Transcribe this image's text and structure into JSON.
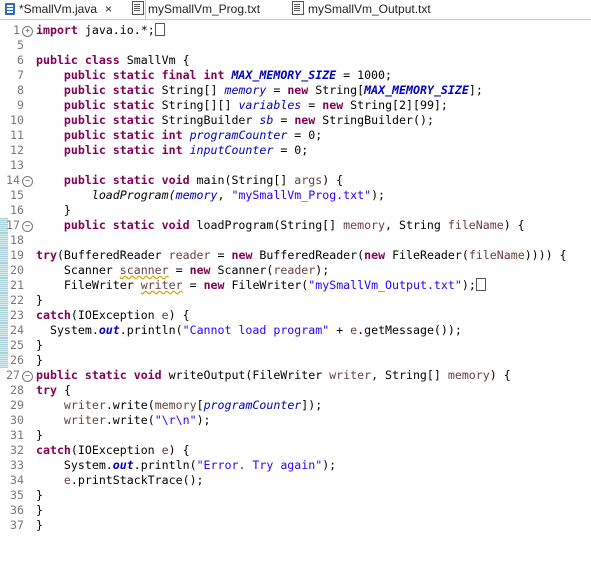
{
  "tabs": [
    {
      "label": "*SmallVm.java",
      "icon": "java-file-icon",
      "active": true,
      "close": "×"
    },
    {
      "label": "mySmallVm_Prog.txt",
      "icon": "text-file-icon",
      "active": false
    },
    {
      "label": "mySmallVm_Output.txt",
      "icon": "text-file-icon",
      "active": false
    }
  ],
  "colors": {
    "keyword": "#7f0055",
    "string": "#2a00ff",
    "field": "#0000c0",
    "local": "#6a3e3e",
    "line_number": "#787878"
  },
  "lines": [
    {
      "n": "1",
      "fold": "+",
      "tokens": [
        [
          "kw",
          "import"
        ],
        [
          "",
          "java.io.*;"
        ],
        [
          "caret",
          ""
        ]
      ]
    },
    {
      "n": "5",
      "tokens": []
    },
    {
      "n": "6",
      "tokens": [
        [
          "kw",
          "public class"
        ],
        [
          "",
          "SmallVm {"
        ]
      ]
    },
    {
      "n": "7",
      "tokens": [
        [
          "",
          "    "
        ],
        [
          "kw",
          "public static final int"
        ],
        [
          "",
          ""
        ],
        [
          "stat",
          "MAX_MEMORY_SIZE"
        ],
        [
          "",
          ""
        ],
        [
          "",
          ""
        ],
        [
          "",
          "= 1000;"
        ]
      ]
    },
    {
      "n": "8",
      "tokens": [
        [
          "",
          "    "
        ],
        [
          "kw",
          "public static"
        ],
        [
          "",
          "String[]"
        ],
        [
          "fld",
          "memory"
        ],
        [
          "",
          "="
        ],
        [
          "kw",
          "new"
        ],
        [
          "",
          "String["
        ],
        [
          "stat",
          "MAX_MEMORY_SIZE"
        ],
        [
          "",
          "];"
        ]
      ]
    },
    {
      "n": "9",
      "tokens": [
        [
          "",
          "    "
        ],
        [
          "kw",
          "public static"
        ],
        [
          "",
          "String[][]"
        ],
        [
          "fld",
          "variables"
        ],
        [
          "",
          "="
        ],
        [
          "kw",
          "new"
        ],
        [
          "",
          "String[2][99];"
        ]
      ]
    },
    {
      "n": "10",
      "tokens": [
        [
          "",
          "    "
        ],
        [
          "kw",
          "public static"
        ],
        [
          "",
          "StringBuilder"
        ],
        [
          "fld",
          "sb"
        ],
        [
          "",
          "="
        ],
        [
          "kw",
          "new"
        ],
        [
          "",
          "StringBuilder();"
        ]
      ]
    },
    {
      "n": "11",
      "tokens": [
        [
          "",
          "    "
        ],
        [
          "kw",
          "public static int"
        ],
        [
          "fld",
          "programCounter"
        ],
        [
          "",
          "= 0;"
        ]
      ]
    },
    {
      "n": "12",
      "tokens": [
        [
          "",
          "    "
        ],
        [
          "kw",
          "public static int"
        ],
        [
          "fld",
          "inputCounter"
        ],
        [
          "",
          "= 0;"
        ]
      ]
    },
    {
      "n": "13",
      "tokens": []
    },
    {
      "n": "14",
      "fold": "−",
      "tokens": [
        [
          "",
          "    "
        ],
        [
          "kw",
          "public static void"
        ],
        [
          "",
          "main(String[]"
        ],
        [
          "loc",
          "args"
        ],
        [
          "",
          ") {"
        ]
      ]
    },
    {
      "n": "15",
      "tokens": [
        [
          "",
          "        "
        ],
        [
          "meth",
          "loadProgram("
        ],
        [
          "fld",
          "memory"
        ],
        [
          "",
          ","
        ],
        [
          "str",
          "\"mySmallVm_Prog.txt\""
        ],
        [
          "",
          ");"
        ]
      ]
    },
    {
      "n": "16",
      "tokens": [
        [
          "",
          "    }"
        ]
      ]
    },
    {
      "n": "17",
      "fold": "−",
      "marker": true,
      "tokens": [
        [
          "",
          "    "
        ],
        [
          "kw",
          "public static void"
        ],
        [
          "",
          "loadProgram(String[]"
        ],
        [
          "loc",
          "memory"
        ],
        [
          "",
          ", String"
        ],
        [
          "loc",
          "fileName"
        ],
        [
          "",
          ") {"
        ]
      ]
    },
    {
      "n": "18",
      "marker": true,
      "tokens": []
    },
    {
      "n": "19",
      "marker": true,
      "tokens": [
        [
          "kw",
          "try"
        ],
        [
          "",
          "(BufferedReader"
        ],
        [
          "loc",
          "reader"
        ],
        [
          "",
          "="
        ],
        [
          "kw",
          "new"
        ],
        [
          "",
          "BufferedReader("
        ],
        [
          "kw",
          "new"
        ],
        [
          "",
          "FileReader("
        ],
        [
          "loc",
          "fileName"
        ],
        [
          "",
          ")))) {"
        ]
      ]
    },
    {
      "n": "20",
      "marker": true,
      "tokens": [
        [
          "",
          "    Scanner"
        ],
        [
          "locw",
          "scanner"
        ],
        [
          "",
          "="
        ],
        [
          "kw",
          "new"
        ],
        [
          "",
          "Scanner("
        ],
        [
          "loc",
          "reader"
        ],
        [
          "",
          ");"
        ]
      ]
    },
    {
      "n": "21",
      "marker": true,
      "tokens": [
        [
          "",
          "    FileWriter"
        ],
        [
          "locw",
          "writer"
        ],
        [
          "",
          "="
        ],
        [
          "kw",
          "new"
        ],
        [
          "",
          "FileWriter("
        ],
        [
          "str",
          "\"mySmallVm_Output.txt\""
        ],
        [
          "",
          ");"
        ],
        [
          "caret",
          ""
        ]
      ]
    },
    {
      "n": "22",
      "marker": true,
      "tokens": [
        [
          "",
          "}"
        ]
      ]
    },
    {
      "n": "23",
      "marker": true,
      "tokens": [
        [
          "kw",
          "catch"
        ],
        [
          "",
          "(IOException"
        ],
        [
          "loc",
          "e"
        ],
        [
          "",
          ") {"
        ]
      ]
    },
    {
      "n": "24",
      "marker": true,
      "tokens": [
        [
          "",
          "  System."
        ],
        [
          "stat",
          "out"
        ],
        [
          "",
          ".println("
        ],
        [
          "str",
          "\"Cannot load program\""
        ],
        [
          "",
          "+"
        ],
        [
          "loc",
          "e"
        ],
        [
          "",
          ".getMessage());"
        ]
      ]
    },
    {
      "n": "25",
      "marker": true,
      "tokens": [
        [
          "",
          "}"
        ]
      ]
    },
    {
      "n": "26",
      "marker": true,
      "tokens": [
        [
          "",
          "}"
        ]
      ]
    },
    {
      "n": "27",
      "fold": "−",
      "tokens": [
        [
          "kw",
          "public static void"
        ],
        [
          "",
          "writeOutput(FileWriter"
        ],
        [
          "loc",
          "writer"
        ],
        [
          "",
          ", String[]"
        ],
        [
          "loc",
          "memory"
        ],
        [
          "",
          ") {"
        ]
      ]
    },
    {
      "n": "28",
      "tokens": [
        [
          "kw",
          "try"
        ],
        [
          "",
          "{"
        ]
      ]
    },
    {
      "n": "29",
      "tokens": [
        [
          "",
          "    "
        ],
        [
          "loc",
          "writer"
        ],
        [
          "",
          ".write("
        ],
        [
          "loc",
          "memory"
        ],
        [
          "",
          "["
        ],
        [
          "fld",
          "programCounter"
        ],
        [
          "",
          "]);"
        ]
      ]
    },
    {
      "n": "30",
      "tokens": [
        [
          "",
          "    "
        ],
        [
          "loc",
          "writer"
        ],
        [
          "",
          ".write("
        ],
        [
          "str",
          "\"\\r\\n\""
        ],
        [
          "",
          ");"
        ]
      ]
    },
    {
      "n": "31",
      "tokens": [
        [
          "",
          "}"
        ]
      ]
    },
    {
      "n": "32",
      "tokens": [
        [
          "kw",
          "catch"
        ],
        [
          "",
          "(IOException"
        ],
        [
          "loc",
          "e"
        ],
        [
          "",
          ") {"
        ]
      ]
    },
    {
      "n": "33",
      "tokens": [
        [
          "",
          "    System."
        ],
        [
          "stat",
          "out"
        ],
        [
          "",
          ".println("
        ],
        [
          "str",
          "\"Error. Try again\""
        ],
        [
          "",
          ");"
        ]
      ]
    },
    {
      "n": "34",
      "tokens": [
        [
          "",
          "    "
        ],
        [
          "loc",
          "e"
        ],
        [
          "",
          ".printStackTrace();"
        ]
      ]
    },
    {
      "n": "35",
      "tokens": [
        [
          "",
          "}"
        ]
      ]
    },
    {
      "n": "36",
      "tokens": [
        [
          "",
          "}"
        ]
      ]
    },
    {
      "n": "37",
      "tokens": [
        [
          "",
          "}"
        ]
      ]
    }
  ]
}
